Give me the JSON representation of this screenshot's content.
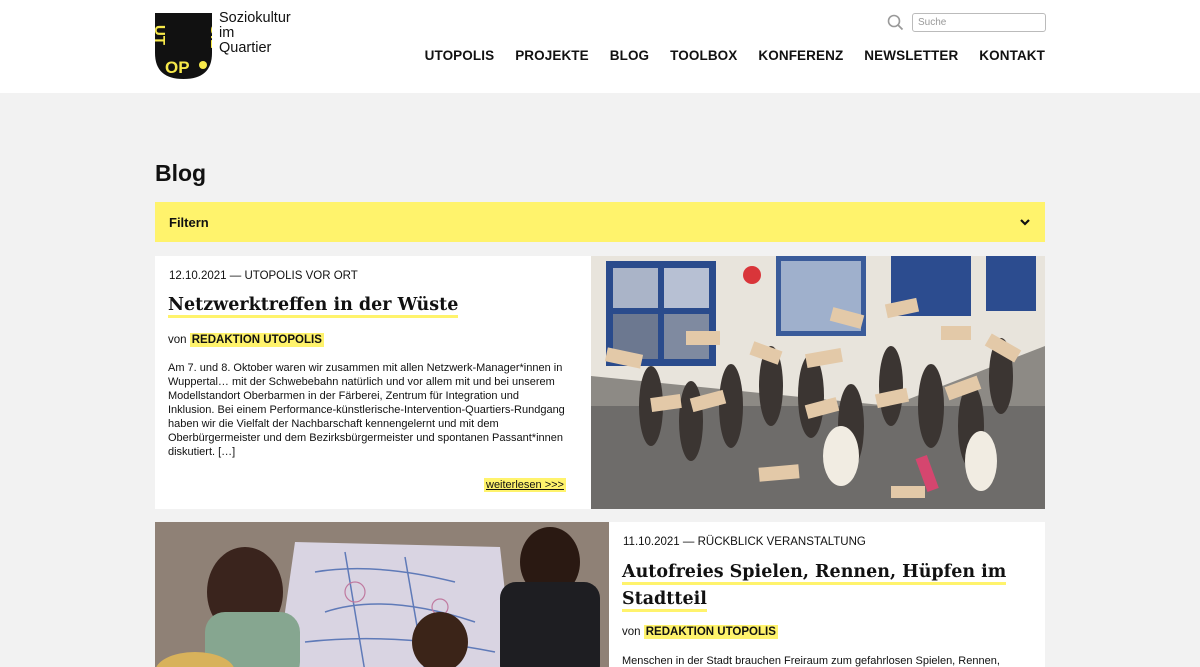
{
  "brand": {
    "logo_letters": "UTOPOLIS",
    "tagline": [
      "Soziokultur",
      "im",
      "Quartier"
    ]
  },
  "search": {
    "placeholder": "Suche"
  },
  "nav": [
    "UTOPOLIS",
    "PROJEKTE",
    "BLOG",
    "TOOLBOX",
    "KONFERENZ",
    "NEWSLETTER",
    "KONTAKT"
  ],
  "page": {
    "title": "Blog"
  },
  "filter": {
    "label": "Filtern"
  },
  "posts": [
    {
      "meta": "12.10.2021 — UTOPOLIS VOR ORT",
      "title": "Netzwerktreffen in der Wüste",
      "author_prefix": "von",
      "author": "REDAKTION UTOPOLIS",
      "excerpt": "Am 7. und 8. Oktober waren wir zusammen mit allen Netzwerk-Manager*innen in Wuppertal… mit der Schwebebahn natürlich und vor allem mit und bei unserem Modellstandort Oberbarmen in der Färberei, Zentrum für Integration und Inklusion. Bei einem Performance-künstlerische-Intervention-Quartiers-Rundgang haben wir die Vielfalt der Nachbarschaft kennengelernt und mit dem Oberbürgermeister und dem Bezirksbürgermeister und spontanen Passant*innen diskutiert. […]",
      "more": "weiterlesen  >>>"
    },
    {
      "meta": "11.10.2021 — RÜCKBLICK VERANSTALTUNG",
      "title": "Autofreies Spielen, Rennen, Hüpfen im Stadtteil",
      "author_prefix": "von",
      "author": "REDAKTION UTOPOLIS",
      "excerpt": "Menschen in der Stadt brauchen Freiraum zum gefahrlosen Spielen, Rennen,"
    }
  ],
  "colors": {
    "accent": "#fff36c",
    "logo_bg": "#111111",
    "logo_fg": "#f7e94a"
  }
}
